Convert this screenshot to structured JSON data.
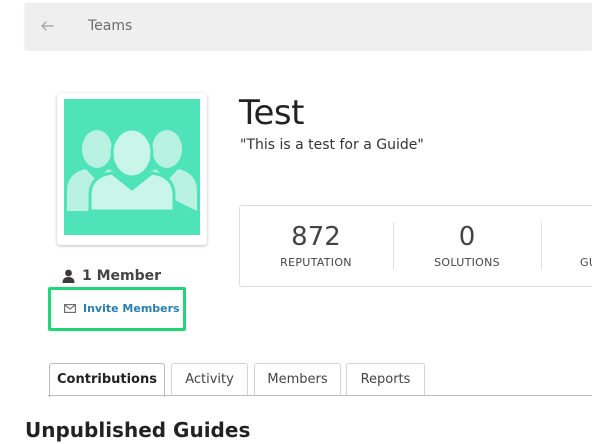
{
  "breadcrumb": {
    "back_icon": "arrow-left-icon",
    "label": "Teams"
  },
  "team": {
    "avatar_icon": "group-silhouette-icon",
    "avatar_color": "#4ee3b8",
    "name": "Test",
    "description": "\"This is a test for a Guide\""
  },
  "stats": [
    {
      "value": "872",
      "label": "REPUTATION"
    },
    {
      "value": "0",
      "label": "SOLUTIONS"
    },
    {
      "value": "",
      "label": "GU"
    }
  ],
  "members": {
    "icon": "user-icon",
    "label": "1 Member"
  },
  "invite": {
    "icon": "envelope-icon",
    "label": "Invite Members",
    "highlight_color": "#20d676"
  },
  "tabs": [
    {
      "label": "Contributions",
      "active": true
    },
    {
      "label": "Activity",
      "active": false
    },
    {
      "label": "Members",
      "active": false
    },
    {
      "label": "Reports",
      "active": false
    }
  ],
  "section": {
    "heading": "Unpublished Guides"
  }
}
